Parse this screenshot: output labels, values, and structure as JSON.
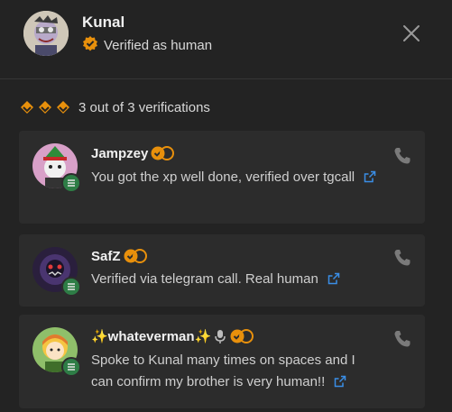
{
  "profile": {
    "name": "Kunal",
    "status": "Verified as human"
  },
  "summary": {
    "text": "3 out of 3 verifications",
    "badge_count": 3
  },
  "colors": {
    "background": "#232323",
    "card": "#2c2c2c",
    "badge_orange": "#e8900c",
    "link_blue": "#3a8ee6",
    "status_green": "#2e7d46",
    "phone_icon": "#7a7a7a"
  },
  "verifications": [
    {
      "name": "Jampzey",
      "message": "You got the xp well done, verified over tgcall",
      "icons": [
        "verified-badge-icon"
      ]
    },
    {
      "name": "SafZ",
      "message": "Verified via telegram call. Real human",
      "icons": [
        "verified-badge-icon"
      ]
    },
    {
      "name": "✨whateverman✨",
      "message": "Spoke to Kunal many times on spaces and I can confirm my brother is very human!!",
      "icons": [
        "microphone-icon",
        "verified-badge-icon"
      ]
    }
  ]
}
